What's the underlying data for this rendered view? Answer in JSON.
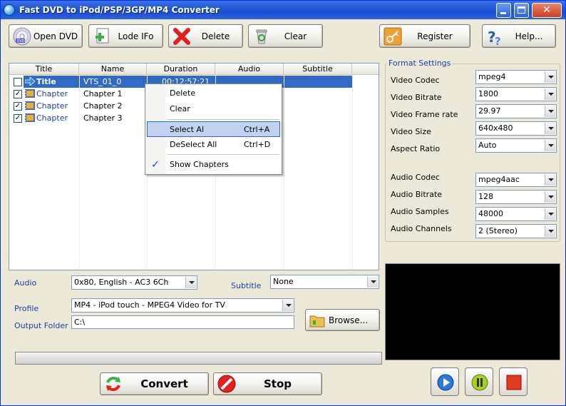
{
  "window": {
    "title": "Fast DVD to iPod/PSP/3GP/MP4 Converter"
  },
  "toolbar": {
    "open_dvd": "Open DVD",
    "lode_ifo": "Lode IFo",
    "delete": "Delete",
    "clear": "Clear",
    "register": "Register",
    "help": "Help..."
  },
  "table": {
    "headers": [
      "Title",
      "Name",
      "Duration",
      "Audio",
      "Subtitle"
    ],
    "rows": [
      {
        "type": "Title",
        "name": "VTS_01_0",
        "duration": "00:12:57:21",
        "checked": false,
        "selected": true
      },
      {
        "type": "Chapter",
        "name": "Chapter 1",
        "duration": "",
        "checked": true,
        "selected": false
      },
      {
        "type": "Chapter",
        "name": "Chapter 2",
        "duration": "",
        "checked": true,
        "selected": false
      },
      {
        "type": "Chapter",
        "name": "Chapter 3",
        "duration": "",
        "checked": true,
        "selected": false
      }
    ]
  },
  "context_menu": {
    "delete": "Delete",
    "clear": "Clear",
    "select_all": "Select Al",
    "select_all_key": "Ctrl+A",
    "deselect_all": "DeSelect All",
    "deselect_all_key": "Ctrl+D",
    "show_chapters": "Show Chapters",
    "check_mark": "✓"
  },
  "format_settings": {
    "title": "Format Settings",
    "video_codec_label": "Video Codec",
    "video_codec": "mpeg4",
    "video_bitrate_label": "Video Bitrate",
    "video_bitrate": "1800",
    "video_frame_rate_label": "Video Frame rate",
    "video_frame_rate": "29.97",
    "video_size_label": "Video Size",
    "video_size": "640x480",
    "aspect_ratio_label": "Aspect Ratio",
    "aspect_ratio": "Auto",
    "audio_codec_label": "Audio Codec",
    "audio_codec": "mpeg4aac",
    "audio_bitrate_label": "Audio Bitrate",
    "audio_bitrate": "128",
    "audio_samples_label": "Audio Samples",
    "audio_samples": "48000",
    "audio_channels_label": "Audio Channels",
    "audio_channels": "2 (Stereo)"
  },
  "options": {
    "audio_label": "Audio",
    "audio_value": "0x80, English - AC3 6Ch",
    "subtitle_label": "Subtitle",
    "subtitle_value": "None",
    "profile_label": "Profile",
    "profile_value": "MP4 - iPod touch - MPEG4 Video for TV",
    "output_label": "Output Folder :",
    "output_value": "C:\\",
    "browse": "Browse..."
  },
  "actions": {
    "convert": "Convert",
    "stop": "Stop"
  },
  "progress": 0,
  "colors": {
    "accent": "#316ac5",
    "label_blue": "#1d3fa8",
    "preview_bg": "#000000"
  }
}
